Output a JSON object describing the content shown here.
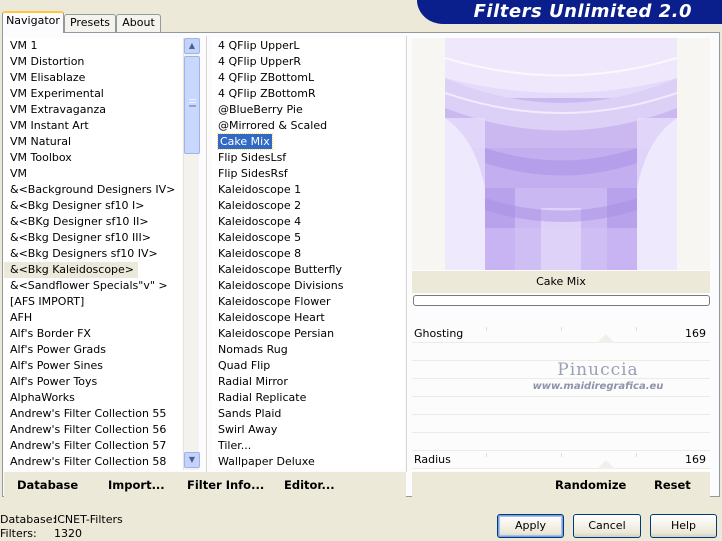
{
  "tabs": [
    "Navigator",
    "Presets",
    "About"
  ],
  "title": "Filters Unlimited 2.0",
  "categories": [
    "VM 1",
    "VM Distortion",
    "VM Elisablaze",
    "VM Experimental",
    "VM Extravaganza",
    "VM Instant Art",
    "VM Natural",
    "VM Toolbox",
    "VM",
    "&<Background Designers IV>",
    "&<Bkg Designer sf10 I>",
    "&<BKg Designer sf10 II>",
    "&<Bkg Designer sf10 III>",
    "&<Bkg Designers sf10 IV>",
    "&<Bkg Kaleidoscope>",
    "&<Sandflower Specials\"v\" >",
    "[AFS IMPORT]",
    "AFH",
    "Alf's Border FX",
    "Alf's Power Grads",
    "Alf's Power Sines",
    "Alf's Power Toys",
    "AlphaWorks",
    "Andrew's Filter Collection 55",
    "Andrew's Filter Collection 56",
    "Andrew's Filter Collection 57",
    "Andrew's Filter Collection 58"
  ],
  "selected_category": "&<Bkg Kaleidoscope>",
  "filters": [
    "4 QFlip UpperL",
    "4 QFlip UpperR",
    "4 QFlip ZBottomL",
    "4 QFlip ZBottomR",
    "@BlueBerry Pie",
    "@Mirrored & Scaled",
    "Cake Mix",
    "Flip SidesLsf",
    "Flip SidesRsf",
    "Kaleidoscope 1",
    "Kaleidoscope 2",
    "Kaleidoscope 4",
    "Kaleidoscope 5",
    "Kaleidoscope 8",
    "Kaleidoscope Butterfly",
    "Kaleidoscope Divisions",
    "Kaleidoscope Flower",
    "Kaleidoscope Heart",
    "Kaleidoscope Persian",
    "Nomads Rug",
    "Quad Flip",
    "Radial Mirror",
    "Radial Replicate",
    "Sands Plaid",
    "Swirl Away",
    "Tiler...",
    "Wallpaper Deluxe"
  ],
  "selected_filter": "Cake Mix",
  "preview": {
    "filter_name": "Cake Mix"
  },
  "params": [
    {
      "label": "Ghosting",
      "value": "169",
      "level": 0.66
    },
    {
      "label": "Radius",
      "value": "169",
      "level": 0.66
    }
  ],
  "watermark": {
    "name": "Pinuccia",
    "url": "www.maidiregrafica.eu"
  },
  "left_buttons": {
    "database": "Database",
    "import": "Import...",
    "filter_info": "Filter Info...",
    "editor": "Editor..."
  },
  "right_buttons": {
    "randomize": "Randomize",
    "reset": "Reset"
  },
  "info": {
    "database_label": "Database:",
    "database_value": "ICNET-Filters",
    "filters_label": "Filters:",
    "filters_value": "1320"
  },
  "dialog_buttons": {
    "apply": "Apply",
    "cancel": "Cancel",
    "help": "Help"
  },
  "colors": {
    "selection": "#316ac5",
    "title_banner": "#0a1e8c",
    "preview_base": "#cbb8f1"
  }
}
